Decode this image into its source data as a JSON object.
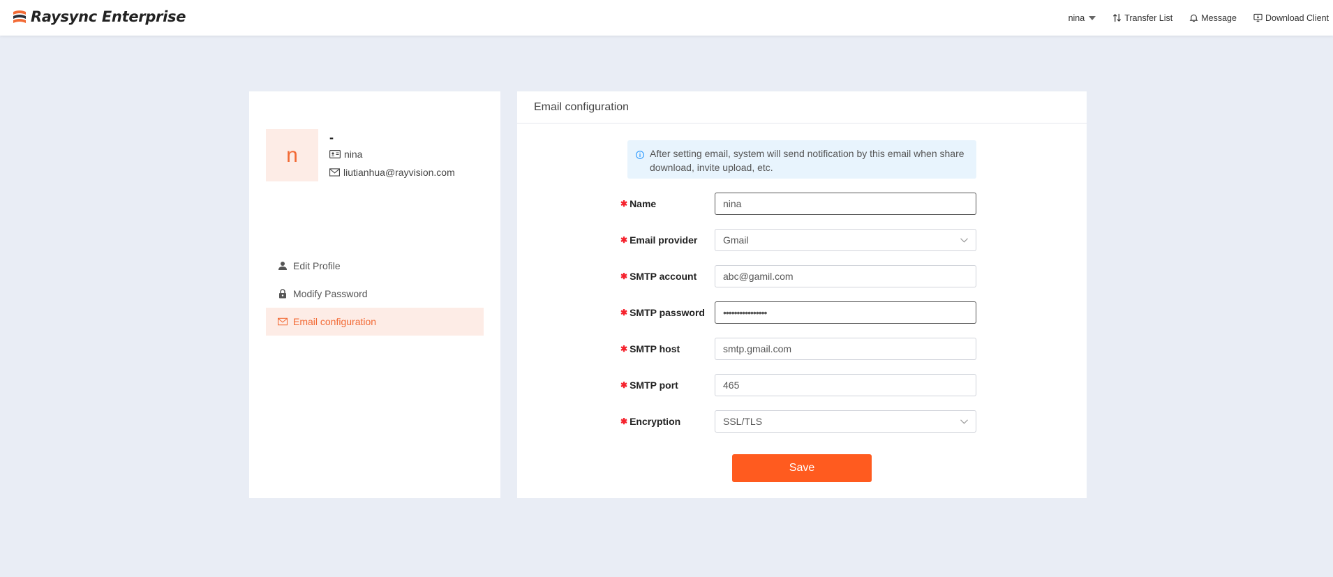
{
  "app": {
    "name": "Raysync Enterprise"
  },
  "header": {
    "user": "nina",
    "transfer_list": "Transfer List",
    "message": "Message",
    "download_client": "Download Client"
  },
  "profile": {
    "avatar_letter": "n",
    "display_name": "-",
    "username": "nina",
    "email": "liutianhua@rayvision.com"
  },
  "menu": {
    "items": [
      {
        "label": "Edit Profile",
        "icon": "user-icon"
      },
      {
        "label": "Modify Password",
        "icon": "lock-icon"
      },
      {
        "label": "Email configuration",
        "icon": "mail-icon",
        "active": true
      }
    ]
  },
  "email_config": {
    "title": "Email configuration",
    "notice": "After setting email, system will send notification by this email when share download, invite upload, etc.",
    "fields": {
      "name": {
        "label": "Name",
        "value": "nina"
      },
      "provider": {
        "label": "Email provider",
        "value": "Gmail"
      },
      "smtp_account": {
        "label": "SMTP account",
        "value": "abc@gamil.com"
      },
      "smtp_password": {
        "label": "SMTP password",
        "value": "••••••••••••••••"
      },
      "smtp_host": {
        "label": "SMTP host",
        "value": "smtp.gmail.com"
      },
      "smtp_port": {
        "label": "SMTP port",
        "value": "465"
      },
      "encryption": {
        "label": "Encryption",
        "value": "SSL/TLS"
      }
    },
    "save_label": "Save"
  },
  "colors": {
    "accent": "#ff5b1f",
    "accent_light": "#fdece6",
    "background": "#e9edf5",
    "info_bg": "#e8f4fd",
    "required": "#f5222d"
  }
}
